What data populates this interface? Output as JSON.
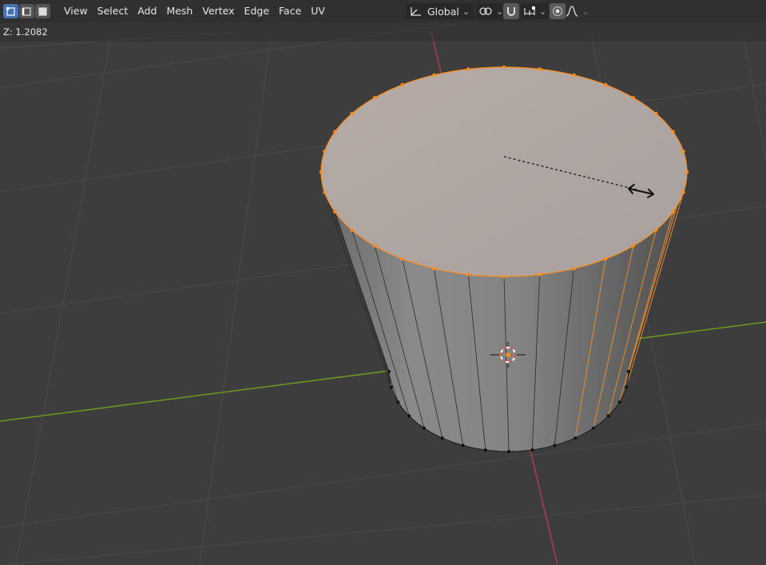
{
  "header": {
    "select_modes": [
      {
        "name": "vertex-select",
        "active": true
      },
      {
        "name": "edge-select",
        "active": false
      },
      {
        "name": "face-select",
        "active": false
      }
    ],
    "menu": [
      "View",
      "Select",
      "Add",
      "Mesh",
      "Vertex",
      "Edge",
      "Face",
      "UV"
    ],
    "transform_orientation": "Global"
  },
  "status": {
    "transform_readout": "Z: 1.2082"
  },
  "colors": {
    "accent": "#4772b3",
    "selection": "#ff8c1a",
    "x_axis": "#b43a4c",
    "y_axis": "#6e9a1f",
    "viewport_bg": "#3d3d3d"
  }
}
